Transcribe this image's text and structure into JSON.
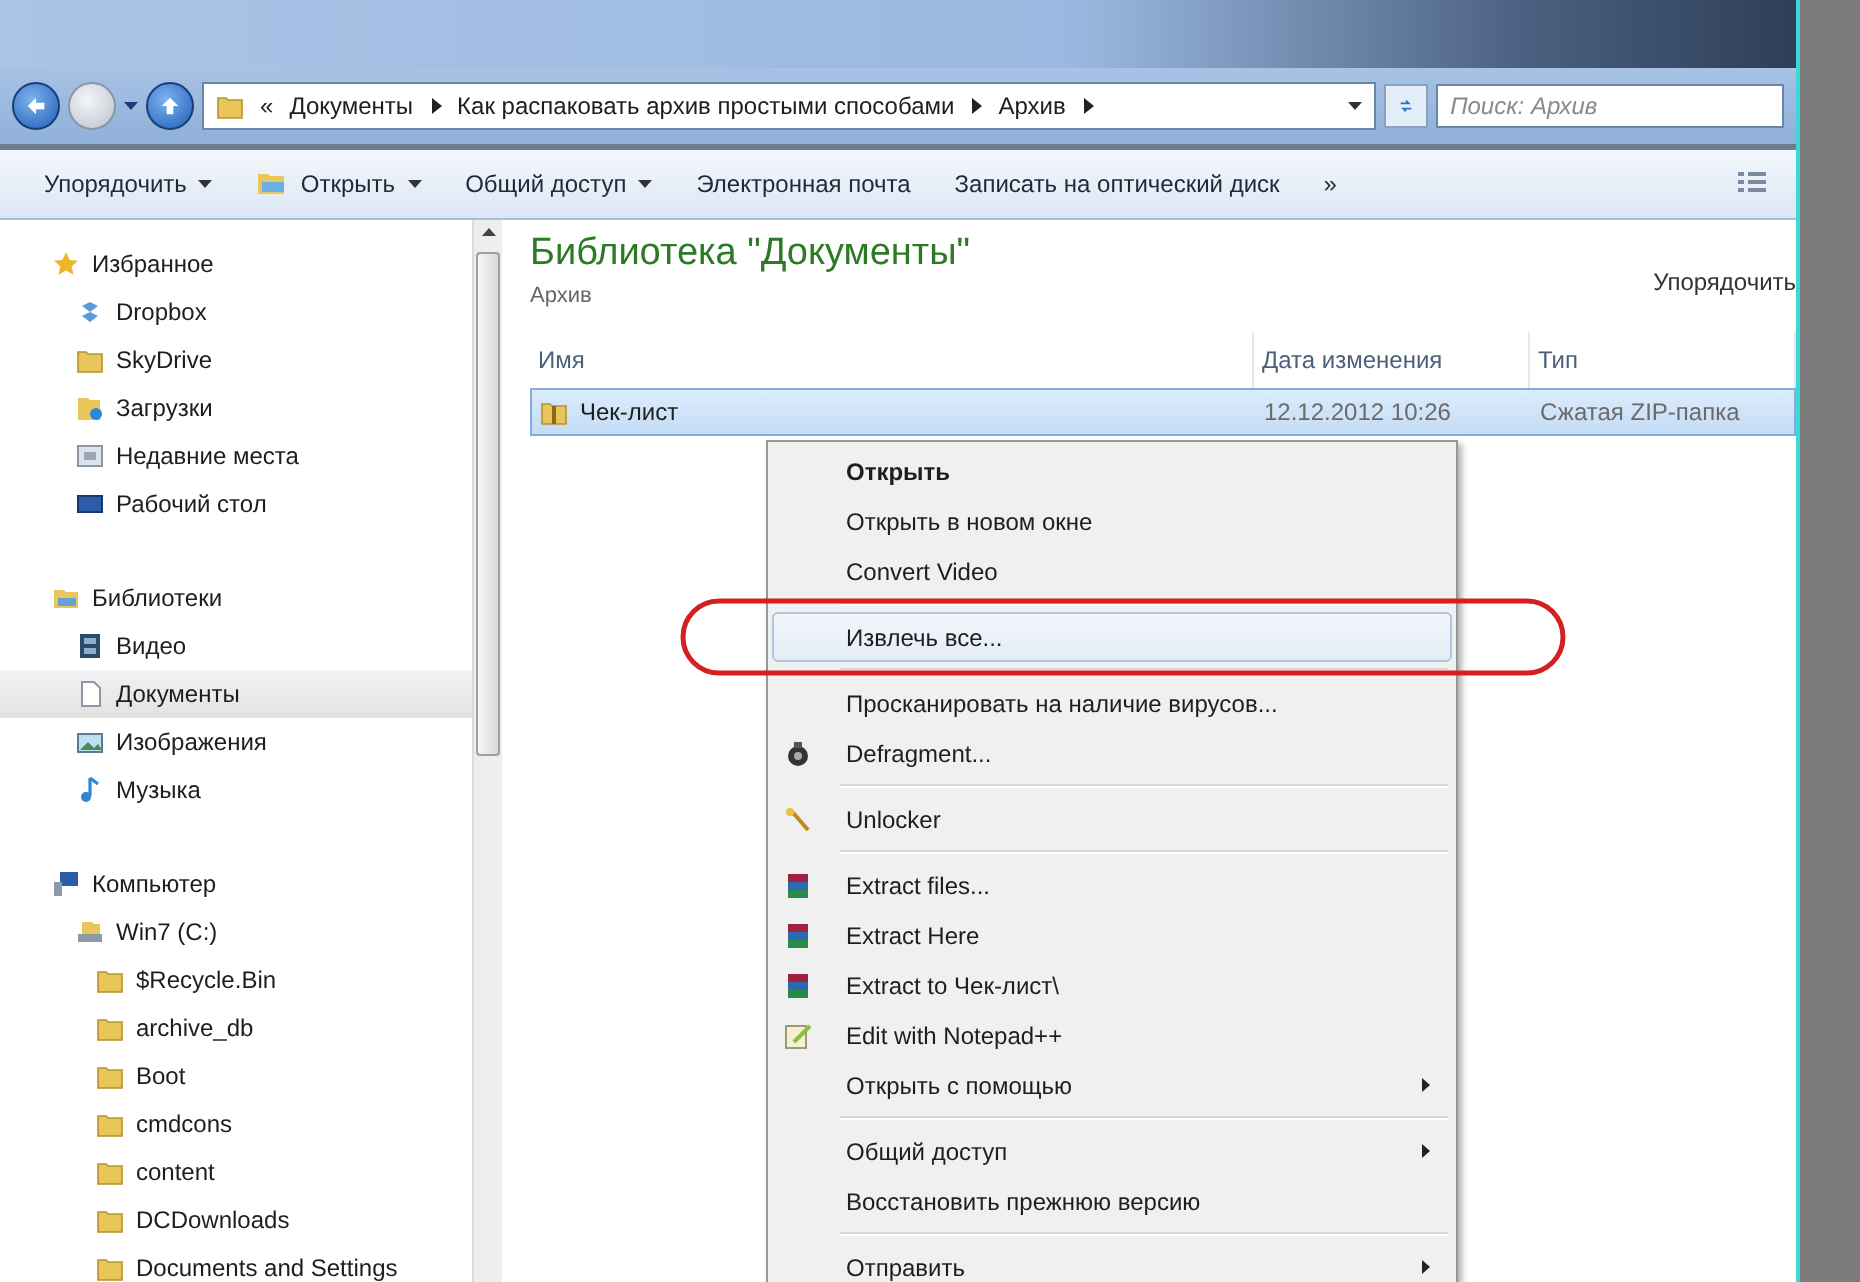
{
  "address_bar": {
    "overflow": "«",
    "crumbs": [
      "Документы",
      "Как распаковать архив простыми способами",
      "Архив"
    ],
    "search": {
      "placeholder": "Поиск: Архив"
    }
  },
  "toolbar": [
    {
      "label": "Упорядочить",
      "dropdown": true
    },
    {
      "label": "Открыть",
      "dropdown": true
    },
    {
      "label": "Общий доступ",
      "dropdown": true
    },
    {
      "label": "Электронная почта",
      "dropdown": false
    },
    {
      "label": "Записать на оптический диск",
      "dropdown": false
    },
    {
      "label": "»",
      "dropdown": false
    }
  ],
  "sidebar": {
    "groups": [
      {
        "label": "Избранное",
        "children": [
          {
            "label": "Dropbox",
            "selected": false
          },
          {
            "label": "SkyDrive",
            "selected": false
          },
          {
            "label": "Загрузки",
            "selected": false
          },
          {
            "label": "Недавние места",
            "selected": false
          },
          {
            "label": "Рабочий стол",
            "selected": false
          }
        ]
      },
      {
        "label": "Библиотеки",
        "children": [
          {
            "label": "Видео",
            "selected": false
          },
          {
            "label": "Документы",
            "selected": true
          },
          {
            "label": "Изображения",
            "selected": false
          },
          {
            "label": "Музыка",
            "selected": false
          }
        ]
      },
      {
        "label": "Компьютер",
        "children": [
          {
            "label": "Win7 (C:)",
            "selected": false,
            "children": [
              {
                "label": "$Recycle.Bin",
                "selected": false
              },
              {
                "label": "archive_db",
                "selected": false
              },
              {
                "label": "Boot",
                "selected": false
              },
              {
                "label": "cmdcons",
                "selected": false
              },
              {
                "label": "content",
                "selected": false
              },
              {
                "label": "DCDownloads",
                "selected": false
              },
              {
                "label": "Documents and Settings",
                "selected": false
              }
            ]
          }
        ]
      }
    ]
  },
  "library": {
    "title": "Библиотека \"Документы\"",
    "subtitle": "Архив",
    "arrange": "Упорядочить"
  },
  "table": {
    "columns": [
      "Имя",
      "Дата изменения",
      "Тип"
    ],
    "rows": [
      {
        "name": "Чек-лист",
        "date": "12.12.2012 10:26",
        "type": "Сжатая ZIP-папка",
        "selected": true
      }
    ]
  },
  "context_menu": {
    "groups": [
      [
        {
          "label": "Открыть",
          "bold": true,
          "selected": false,
          "submenu": false
        },
        {
          "label": "Открыть в новом окне",
          "bold": false,
          "selected": false,
          "submenu": false
        },
        {
          "label": "Convert Video",
          "bold": false,
          "selected": false,
          "submenu": false
        }
      ],
      [
        {
          "label": "Извлечь все...",
          "bold": false,
          "selected": true,
          "submenu": false,
          "highlighted": true
        }
      ],
      [
        {
          "label": "Просканировать на наличие вирусов...",
          "bold": false,
          "selected": false,
          "submenu": false
        },
        {
          "label": "Defragment...",
          "bold": false,
          "selected": false,
          "submenu": false
        }
      ],
      [
        {
          "label": "Unlocker",
          "bold": false,
          "selected": false,
          "submenu": false
        }
      ],
      [
        {
          "label": "Extract files...",
          "bold": false,
          "selected": false,
          "submenu": false
        },
        {
          "label": "Extract Here",
          "bold": false,
          "selected": false,
          "submenu": false
        },
        {
          "label": "Extract to Чек-лист\\",
          "bold": false,
          "selected": false,
          "submenu": false
        },
        {
          "label": "Edit with Notepad++",
          "bold": false,
          "selected": false,
          "submenu": false
        },
        {
          "label": "Открыть с помощью",
          "bold": false,
          "selected": false,
          "submenu": true
        }
      ],
      [
        {
          "label": "Общий доступ",
          "bold": false,
          "selected": false,
          "submenu": true
        },
        {
          "label": "Восстановить прежнюю версию",
          "bold": false,
          "selected": false,
          "submenu": false
        }
      ],
      [
        {
          "label": "Отправить",
          "bold": false,
          "selected": false,
          "submenu": true
        }
      ]
    ]
  }
}
